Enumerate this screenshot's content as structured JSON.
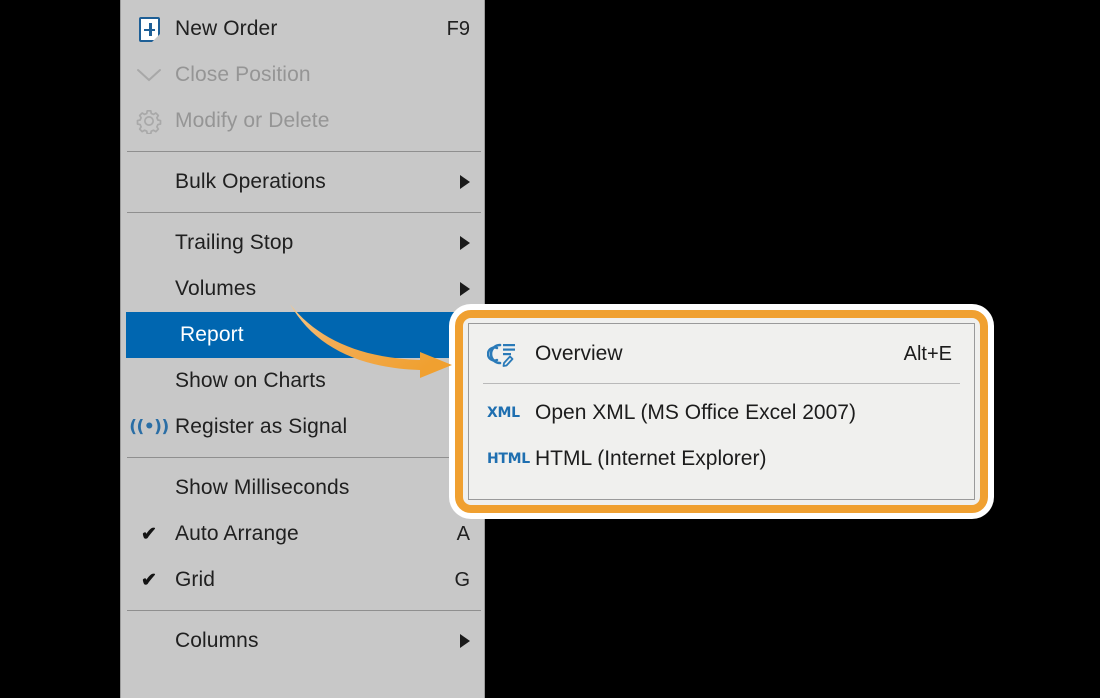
{
  "theme": {
    "menu_background": "#c8c8c8",
    "highlight_blue": "#0066b0",
    "accent_orange": "#f0a030",
    "submenu_background": "#f0f0ee",
    "icon_blue": "#2a6ea5",
    "text_color": "#202020",
    "disabled_text_color": "#959595"
  },
  "context_menu": {
    "name": "trade-context-menu",
    "groups": [
      {
        "items": [
          {
            "icon": "new-order-icon",
            "label": "New Order",
            "accel": "F9",
            "state": "enabled",
            "submenu": false,
            "checked": false
          },
          {
            "icon": "close-position-icon",
            "label": "Close Position",
            "accel": "",
            "state": "disabled",
            "submenu": false,
            "checked": false
          },
          {
            "icon": "gear-icon",
            "label": "Modify or Delete",
            "accel": "",
            "state": "disabled",
            "submenu": false,
            "checked": false
          }
        ]
      },
      {
        "items": [
          {
            "icon": "",
            "label": "Bulk Operations",
            "accel": "",
            "state": "enabled",
            "submenu": true,
            "checked": false
          }
        ]
      },
      {
        "items": [
          {
            "icon": "",
            "label": "Trailing Stop",
            "accel": "",
            "state": "enabled",
            "submenu": true,
            "checked": false
          },
          {
            "icon": "",
            "label": "Volumes",
            "accel": "",
            "state": "enabled",
            "submenu": true,
            "checked": false
          },
          {
            "icon": "",
            "label": "Report",
            "accel": "",
            "state": "highlighted",
            "submenu": false,
            "checked": false
          },
          {
            "icon": "",
            "label": "Show on Charts",
            "accel": "",
            "state": "enabled",
            "submenu": false,
            "checked": false
          },
          {
            "icon": "signal-icon",
            "label": "Register as Signal",
            "accel": "",
            "state": "enabled",
            "submenu": false,
            "checked": false
          }
        ]
      },
      {
        "items": [
          {
            "icon": "",
            "label": "Show Milliseconds",
            "accel": "",
            "state": "enabled",
            "submenu": false,
            "checked": false
          },
          {
            "icon": "check-icon",
            "label": "Auto Arrange",
            "accel": "A",
            "state": "enabled",
            "submenu": false,
            "checked": true
          },
          {
            "icon": "check-icon",
            "label": "Grid",
            "accel": "G",
            "state": "enabled",
            "submenu": false,
            "checked": true
          }
        ]
      },
      {
        "items": [
          {
            "icon": "",
            "label": "Columns",
            "accel": "",
            "state": "enabled",
            "submenu": true,
            "checked": false
          }
        ]
      }
    ]
  },
  "report_submenu": {
    "name": "report-submenu",
    "items": [
      {
        "icon": "overview-report-icon",
        "label": "Overview",
        "accel": "Alt+E"
      },
      {
        "icon": "xml-icon",
        "label": "Open XML (MS Office Excel 2007)",
        "accel": ""
      },
      {
        "icon": "html-icon",
        "label": "HTML (Internet Explorer)",
        "accel": ""
      }
    ],
    "icon_labels": {
      "xml": "XML",
      "html": "HTML"
    }
  },
  "annotation": {
    "arrow": "curved-orange-arrow",
    "arrow_color": "#f0a030",
    "callout_box": "orange-highlight-box"
  }
}
